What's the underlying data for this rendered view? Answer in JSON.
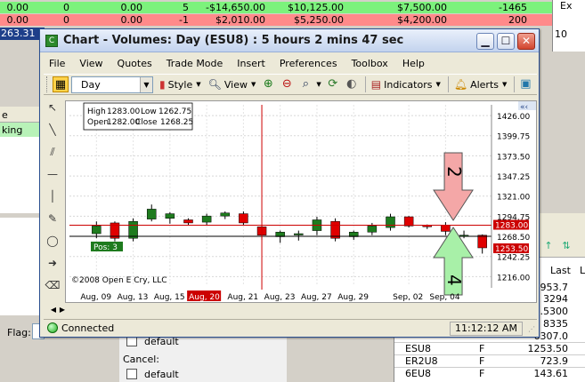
{
  "background": {
    "row1": [
      "0.00",
      "0",
      "0.00",
      "5",
      "-$14,650.00",
      "$10,125.00",
      "$7,500.00",
      "-1465"
    ],
    "row2": [
      "0.00",
      "0",
      "0.00",
      "-1",
      "$2,010.00",
      "$5,250.00",
      "$4,200.00",
      "200"
    ],
    "row3_value": "263.31",
    "right_strip_top": "Ex",
    "right_strip_value": "10",
    "left_panel_header": "e",
    "left_panel_selected": "king",
    "flag_label": "Flag:",
    "bottom_panel": {
      "cb1_label": "default",
      "cancel_label": "Cancel:",
      "cb2_label": "default"
    },
    "grid": {
      "col_header": "Last",
      "col_header2": "L",
      "rows": [
        {
          "sym": "",
          "typ": "",
          "val": "953.7"
        },
        {
          "sym": "",
          "typ": "",
          "val": "3294"
        },
        {
          "sym": "",
          "typ": "",
          "val": "9.5300"
        },
        {
          "sym": "",
          "typ": "",
          "val": "8335"
        },
        {
          "sym": "",
          "typ": "",
          "val": "6307.0"
        },
        {
          "sym": "ESU8",
          "typ": "F",
          "val": "1253.50"
        },
        {
          "sym": "ER2U8",
          "typ": "F",
          "val": "723.9"
        },
        {
          "sym": "6EU8",
          "typ": "F",
          "val": "143.61"
        }
      ]
    }
  },
  "window": {
    "title": "Chart - Volumes: Day (ESU8) : 5 hours 2 mins 47 sec",
    "app_icon_letter": "C",
    "menu": [
      "File",
      "View",
      "Quotes",
      "Trade Mode",
      "Insert",
      "Preferences",
      "Toolbox",
      "Help"
    ],
    "toolbar": {
      "period": "Day",
      "style": "Style",
      "view": "View",
      "indicators": "Indicators",
      "alerts": "Alerts"
    },
    "status": {
      "connection": "Connected",
      "time": "11:12:12 AM"
    }
  },
  "colors": {
    "up": "#1e7b1e",
    "down": "#e00000",
    "price_tag_red": "#cc0000",
    "arrow_pink": "#f4a7a7",
    "arrow_green": "#a8f0a8",
    "pos_green": "#1e7b1e"
  },
  "chart_data": {
    "type": "candlestick",
    "title": "",
    "ohlc_box": {
      "high_label": "High",
      "high": "1283.00",
      "low_label": "Low",
      "low": "1262.75",
      "open_label": "Open",
      "open": "1282.00",
      "close_label": "Close",
      "close": "1268.25"
    },
    "y_ticks": [
      1426.0,
      1399.75,
      1373.5,
      1347.25,
      1321.0,
      1294.75,
      1268.5,
      1242.25,
      1216.0
    ],
    "y_tick_labels": [
      "1426.00",
      "1399.75",
      "1373.50",
      "1347.25",
      "1321.00",
      "1294.75",
      "1268.50",
      "1242.25",
      "1216.00"
    ],
    "ylim": [
      1206,
      1440
    ],
    "x_labels": [
      "Aug, 09",
      "Aug, 13",
      "Aug, 15",
      "Aug, 20",
      "Aug, 21",
      "Aug, 23",
      "Aug, 27",
      "Aug, 29",
      "Sep, 02",
      "Sep, 04"
    ],
    "highlighted_x_label": "Aug, 20",
    "candles": [
      {
        "o": 1272,
        "h": 1288,
        "l": 1266,
        "c": 1282
      },
      {
        "o": 1286,
        "h": 1288,
        "l": 1262,
        "c": 1266
      },
      {
        "o": 1266,
        "h": 1292,
        "l": 1262,
        "c": 1288
      },
      {
        "o": 1291,
        "h": 1310,
        "l": 1288,
        "c": 1304
      },
      {
        "o": 1292,
        "h": 1300,
        "l": 1285,
        "c": 1298
      },
      {
        "o": 1290,
        "h": 1292,
        "l": 1283,
        "c": 1286
      },
      {
        "o": 1287,
        "h": 1298,
        "l": 1283,
        "c": 1295
      },
      {
        "o": 1295,
        "h": 1301,
        "l": 1291,
        "c": 1299
      },
      {
        "o": 1298,
        "h": 1301,
        "l": 1283,
        "c": 1286
      },
      {
        "o": 1281,
        "h": 1283,
        "l": 1264,
        "c": 1270
      },
      {
        "o": 1268,
        "h": 1276,
        "l": 1260,
        "c": 1274
      },
      {
        "o": 1272,
        "h": 1276,
        "l": 1263,
        "c": 1272
      },
      {
        "o": 1276,
        "h": 1294,
        "l": 1270,
        "c": 1290
      },
      {
        "o": 1288,
        "h": 1292,
        "l": 1262,
        "c": 1266
      },
      {
        "o": 1268,
        "h": 1276,
        "l": 1264,
        "c": 1274
      },
      {
        "o": 1274,
        "h": 1286,
        "l": 1270,
        "c": 1282
      },
      {
        "o": 1280,
        "h": 1298,
        "l": 1276,
        "c": 1294
      },
      {
        "o": 1294,
        "h": 1295,
        "l": 1280,
        "c": 1282
      },
      {
        "o": 1283,
        "h": 1284,
        "l": 1278,
        "c": 1281
      },
      {
        "o": 1283,
        "h": 1287,
        "l": 1270,
        "c": 1275
      },
      {
        "o": 1270,
        "h": 1276,
        "l": 1266,
        "c": 1270
      },
      {
        "o": 1270,
        "h": 1271,
        "l": 1246,
        "c": 1253.5
      }
    ],
    "cursor_x_candle_index": 9,
    "current_price_label": "1283.00",
    "last_price_label": "1253.50",
    "position_label": "Pos: 3",
    "position_price": 1253.5,
    "hline_price": 1268.5,
    "sell_arrow_label": "2",
    "buy_arrow_label": "4",
    "copyright": "©2008 Open E Cry, LLC"
  }
}
